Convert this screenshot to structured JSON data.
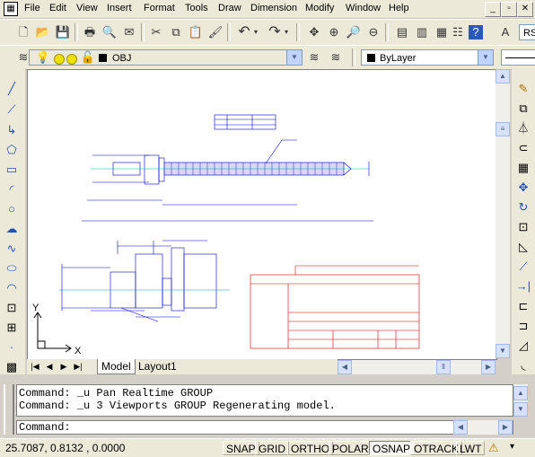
{
  "menu": [
    "File",
    "Edit",
    "View",
    "Insert",
    "Format",
    "Tools",
    "Draw",
    "Dimension",
    "Modify",
    "Window",
    "Help"
  ],
  "toolbar_style": {
    "text_style": "RS"
  },
  "layers": {
    "current_layer": "OBJ",
    "color_control": "ByLayer"
  },
  "tabs": {
    "model": "Model",
    "layout1": "Layout1"
  },
  "command": {
    "history": [
      "Command: _u Pan Realtime GROUP",
      "Command: _u 3 Viewports GROUP Regenerating model."
    ],
    "prompt": "Command:"
  },
  "status": {
    "coordinates": "25.7087, 0.8132 , 0.0000",
    "toggles": [
      "SNAP",
      "GRID",
      "ORTHO",
      "POLAR",
      "OSNAP",
      "OTRACK",
      "LWT"
    ],
    "active": [
      "OSNAP"
    ]
  },
  "ucs": {
    "x_label": "X",
    "y_label": "Y"
  },
  "colors": {
    "dim_blue": "#0000cc",
    "title_red": "#cc0000",
    "cyan": "#00aaaa",
    "green": "#00aa00"
  }
}
